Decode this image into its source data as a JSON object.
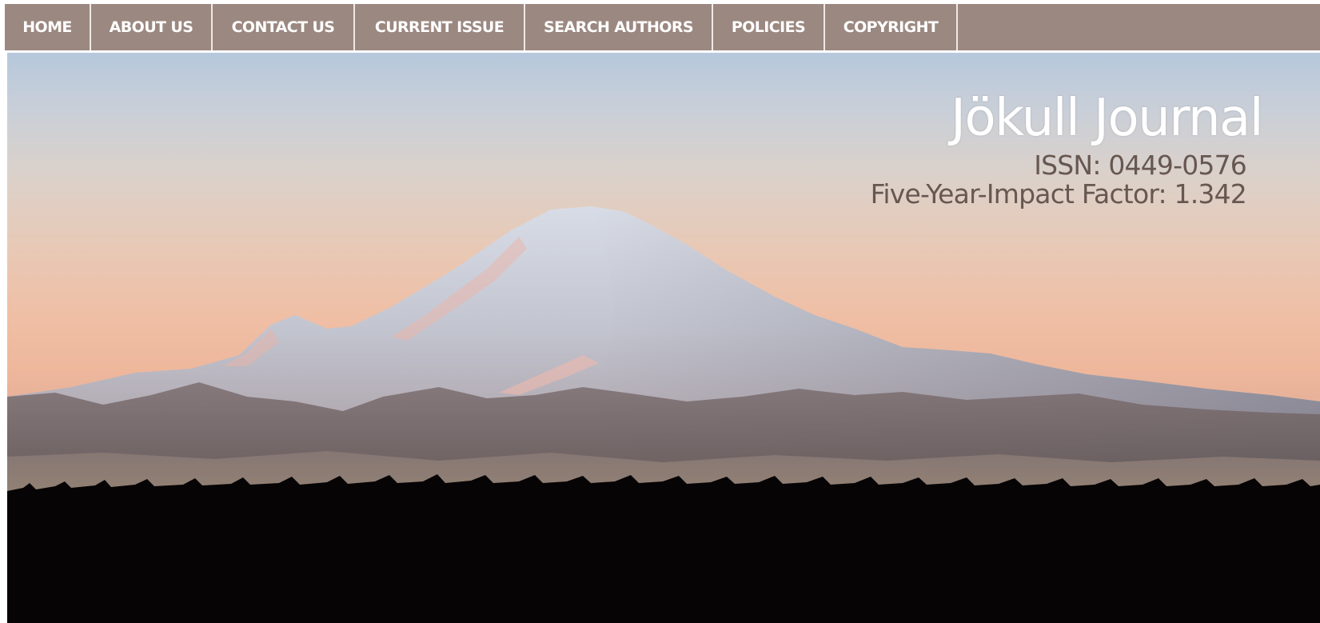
{
  "nav": {
    "items": [
      {
        "label": "HOME"
      },
      {
        "label": "ABOUT US"
      },
      {
        "label": "CONTACT US"
      },
      {
        "label": "CURRENT ISSUE"
      },
      {
        "label": "SEARCH AUTHORS"
      },
      {
        "label": "POLICIES"
      },
      {
        "label": "COPYRIGHT"
      }
    ]
  },
  "header": {
    "title": "Jökull Journal",
    "issn": "ISSN: 0449-0576",
    "impact_factor": "Five-Year-Impact Factor: 1.342"
  },
  "hero": {
    "image": "mountain-landscape"
  },
  "colors": {
    "nav_background": "#9b8880",
    "nav_text": "#ffffff",
    "title_text": "#ffffff",
    "meta_text": "#675751"
  }
}
